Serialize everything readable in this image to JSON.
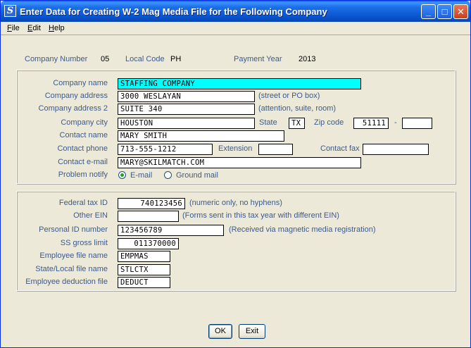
{
  "window": {
    "title": "Enter Data for Creating W-2 Mag Media File for the Following Company",
    "icon_letter": "S",
    "controls": {
      "minimize": "_",
      "maximize": "□",
      "close": "✕"
    }
  },
  "menu": {
    "file": {
      "mnemonic": "F",
      "rest": "ile"
    },
    "edit": {
      "mnemonic": "E",
      "rest": "dit"
    },
    "help": {
      "mnemonic": "H",
      "rest": "elp"
    }
  },
  "header": {
    "company_number_label": "Company Number",
    "company_number": "05",
    "local_code_label": "Local Code",
    "local_code": "PH",
    "payment_year_label": "Payment Year",
    "payment_year": "2013"
  },
  "company": {
    "name_label": "Company name",
    "name": "STAFFING COMPANY",
    "address_label": "Company address",
    "address": "3000 WESLAYAN",
    "address_note": "(street or PO box)",
    "address2_label": "Company address 2",
    "address2": "SUITE 340",
    "address2_note": "(attention, suite, room)",
    "city_label": "Company city",
    "city": "HOUSTON",
    "state_label": "State",
    "state": "TX",
    "zip_label": "Zip code",
    "zip": "51111",
    "zip_sep": "-",
    "zip_ext": "",
    "contact_name_label": "Contact name",
    "contact_name": "MARY SMITH",
    "contact_phone_label": "Contact phone",
    "contact_phone": "713-555-1212",
    "extension_label": "Extension",
    "extension": "",
    "contact_fax_label": "Contact fax",
    "contact_fax": "",
    "contact_email_label": "Contact e-mail",
    "contact_email": "MARY@SKILMATCH.COM",
    "problem_notify_label": "Problem notify",
    "notify_email_label": "E-mail",
    "notify_ground_label": "Ground mail",
    "notify_selected": "E-mail"
  },
  "tax": {
    "federal_tax_id_label": "Federal tax ID",
    "federal_tax_id": "740123456",
    "federal_tax_id_note": "(numeric only, no hyphens)",
    "other_ein_label": "Other EIN",
    "other_ein": "",
    "other_ein_note": "(Forms sent in this tax year with different EIN)",
    "personal_id_label": "Personal ID number",
    "personal_id": "123456789",
    "personal_id_note": "(Received via magnetic media registration)",
    "ss_gross_limit_label": "SS gross limit",
    "ss_gross_limit": "011370000",
    "employee_file_label": "Employee file name",
    "employee_file": "EMPMAS",
    "state_local_file_label": "State/Local file name",
    "state_local_file": "STLCTX",
    "employee_deduction_label": "Employee deduction file",
    "employee_deduction": "DEDUCT"
  },
  "buttons": {
    "ok": "OK",
    "exit": "Exit"
  },
  "colors": {
    "highlight_field": "#00ffff",
    "label_blue": "#3d5a8c",
    "title_blue": "#0a58d2"
  }
}
